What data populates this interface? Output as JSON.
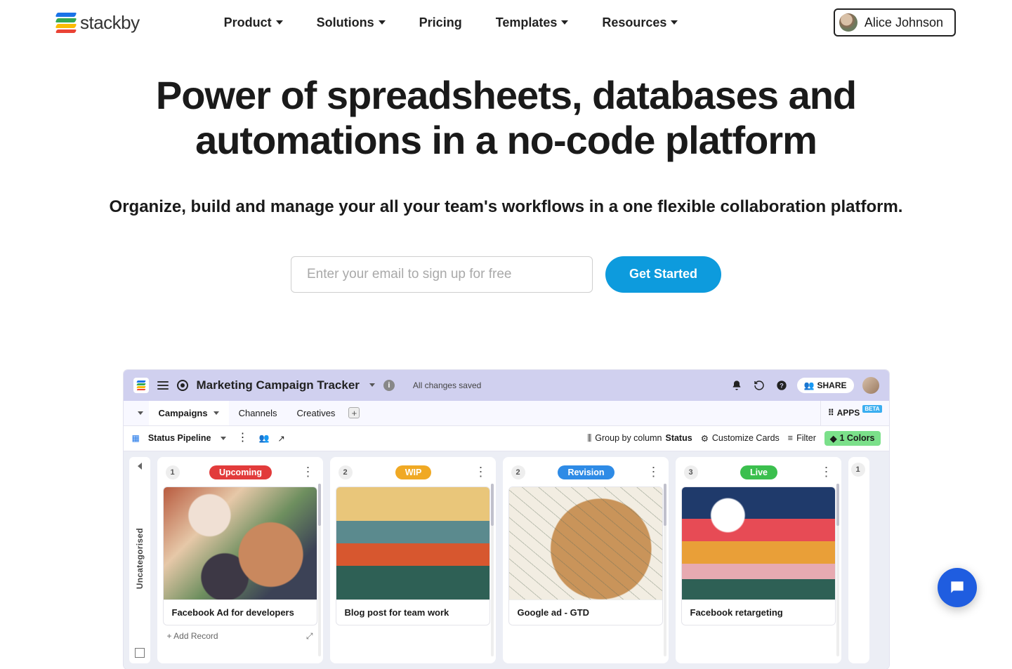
{
  "nav": {
    "brand": "stackby",
    "items": [
      {
        "label": "Product",
        "hasCaret": true
      },
      {
        "label": "Solutions",
        "hasCaret": true
      },
      {
        "label": "Pricing",
        "hasCaret": false
      },
      {
        "label": "Templates",
        "hasCaret": true
      },
      {
        "label": "Resources",
        "hasCaret": true
      }
    ],
    "user": "Alice Johnson"
  },
  "hero": {
    "title": "Power of spreadsheets, databases and automations in a no-code platform",
    "subtitle": "Organize, build and manage your all your team's workflows in a one flexible collaboration platform.",
    "emailPlaceholder": "Enter your email to sign up for free",
    "cta": "Get Started"
  },
  "app": {
    "title": "Marketing Campaign Tracker",
    "savedText": "All changes saved",
    "shareLabel": "SHARE",
    "appsLabel": "APPS",
    "betaLabel": "BETA",
    "tabs": [
      {
        "label": "Campaigns",
        "active": true,
        "hasCaret": true
      },
      {
        "label": "Channels",
        "active": false,
        "hasCaret": false
      },
      {
        "label": "Creatives",
        "active": false,
        "hasCaret": false
      }
    ],
    "view": {
      "name": "Status Pipeline",
      "groupByPrefix": "Group by column ",
      "groupByCol": "Status",
      "customize": "Customize Cards",
      "filter": "Filter",
      "colors": "1 Colors"
    },
    "sideLabel": "Uncategorised",
    "addRecord": "+ Add Record",
    "columns": [
      {
        "count": "1",
        "status": "Upcoming",
        "pillClass": "pill-upcoming",
        "card": "Facebook Ad for developers",
        "img": "img1",
        "showAdd": true
      },
      {
        "count": "2",
        "status": "WIP",
        "pillClass": "pill-wip",
        "card": "Blog post for team work",
        "img": "img2",
        "showAdd": false
      },
      {
        "count": "2",
        "status": "Revision",
        "pillClass": "pill-revision",
        "card": "Google ad - GTD",
        "img": "img3",
        "showAdd": false
      },
      {
        "count": "3",
        "status": "Live",
        "pillClass": "pill-live",
        "card": "Facebook retargeting",
        "img": "img4",
        "showAdd": false
      }
    ],
    "truncCount": "1"
  }
}
